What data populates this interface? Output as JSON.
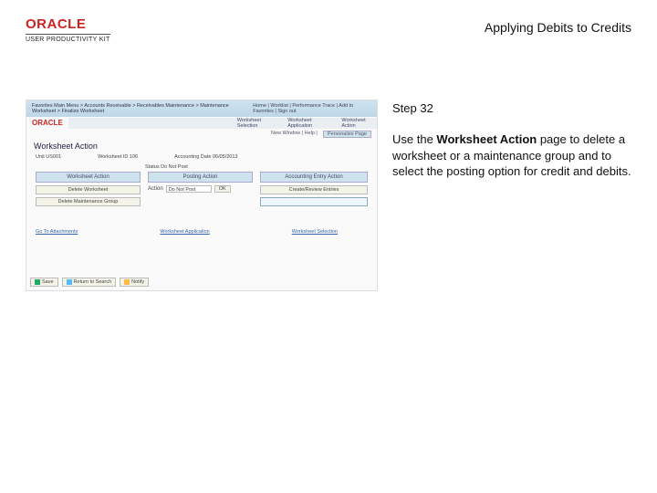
{
  "header": {
    "logo_text": "ORACLE",
    "subtitle": "USER PRODUCTIVITY KIT",
    "title": "Applying Debits to Credits"
  },
  "sidepanel": {
    "step": "Step 32",
    "desc_before": "Use the ",
    "desc_bold": "Worksheet Action",
    "desc_after": " page to delete a worksheet or a maintenance group and to select the posting option for credit and debits."
  },
  "screenshot": {
    "top_left": "Favorites   Main Menu   >  Accounts Receivable  >  Receivables Maintenance  >  Maintenance Worksheet  >  Finalize Worksheet",
    "top_right": "Home | Worklist | Performance Trace | Add to Favorites | Sign out",
    "logo": "ORACLE",
    "tabs": [
      "Worksheet Selection",
      "Worksheet Application",
      "Worksheet Action"
    ],
    "sub_newwin": "New Window | Help |",
    "sub_personalize": "Personalize Page",
    "page_title": "Worksheet Action",
    "row1": {
      "unit": "Unit  US001",
      "wsid": "Worksheet ID  106",
      "acct": "Accounting Date  06/05/2013"
    },
    "status_label": "Status",
    "status_value": "Do Not Post",
    "cols": {
      "worksheet_action": "Worksheet Action",
      "posting_action": "Posting Action",
      "accounting_entry_action": "Accounting Entry Action"
    },
    "buttons": {
      "delete_worksheet": "Delete Worksheet",
      "delete_maint_group": "Delete Maintenance Group",
      "ok": "OK",
      "create_review": "Create/Review Entries"
    },
    "action_label": "Action",
    "action_value": "Do Not Post",
    "links": {
      "attachments": "Go To Attachments",
      "ws_app": "Worksheet Application",
      "ws_sel": "Worksheet Selection"
    },
    "footer": {
      "save": "Save",
      "return": "Return to Search",
      "notify": "Notify"
    }
  }
}
